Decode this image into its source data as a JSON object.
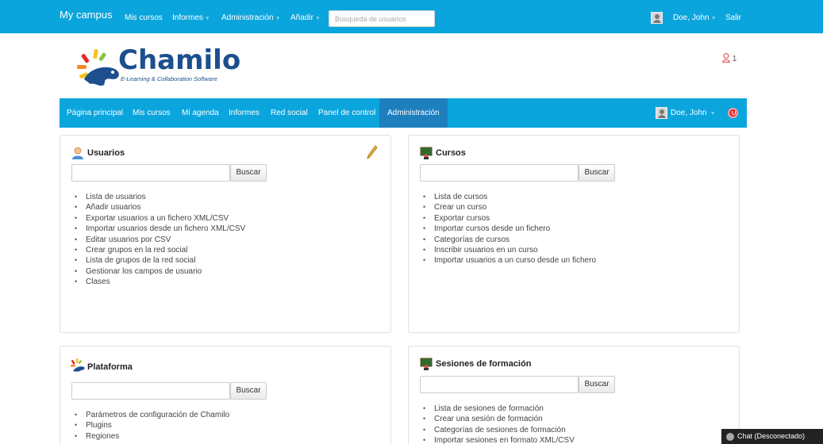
{
  "topbar": {
    "brand": "My campus",
    "nav": [
      {
        "label": "Mis cursos",
        "dropdown": false
      },
      {
        "label": "Informes",
        "dropdown": true
      },
      {
        "label": "Administración",
        "dropdown": true
      },
      {
        "label": "Añadir",
        "dropdown": true
      }
    ],
    "search_placeholder": "Búsqueda de usuarios",
    "user_name": "Doe, John",
    "logout_label": "Salir"
  },
  "logo": {
    "name": "Chamilo",
    "tagline": "E-Learning & Collaboration Software"
  },
  "notifications": {
    "count": "1"
  },
  "navbar": {
    "items": [
      "Página principal",
      "Mis cursos",
      "Mi agenda",
      "Informes",
      "Red social",
      "Panel de control",
      "Administración"
    ],
    "active": "Administración",
    "user_name": "Doe, John"
  },
  "panels": {
    "usuarios": {
      "title": "Usuarios",
      "button": "Buscar",
      "links": [
        "Lista de usuarios",
        "Añadir usuarios",
        "Exportar usuarios a un fichero XML/CSV",
        "Importar usuarios desde un fichero XML/CSV",
        "Editar usuarios por CSV",
        "Crear grupos en la red social",
        "Lista de grupos de la red social",
        "Gestionar los campos de usuario",
        "Clases"
      ]
    },
    "cursos": {
      "title": "Cursos",
      "button": "Buscar",
      "links": [
        "Lista de cursos",
        "Crear un curso",
        "Exportar cursos",
        "Importar cursos desde un fichero",
        "Categorías de cursos",
        "Inscribir usuarios en un curso",
        "Importar usuarios a un curso desde un fichero"
      ]
    },
    "plataforma": {
      "title": "Plataforma",
      "button": "Buscar",
      "links": [
        "Parámetros de configuración de Chamilo",
        "Plugins",
        "Regiones"
      ]
    },
    "sesiones": {
      "title": "Sesiones de formación",
      "button": "Buscar",
      "links": [
        "Lista de sesiones de formación",
        "Crear una sesión de formación",
        "Categorías de sesiones de formación",
        "Importar sesiones en formato XML/CSV"
      ]
    }
  },
  "chat": {
    "label": "Chat (Desconectado)"
  }
}
